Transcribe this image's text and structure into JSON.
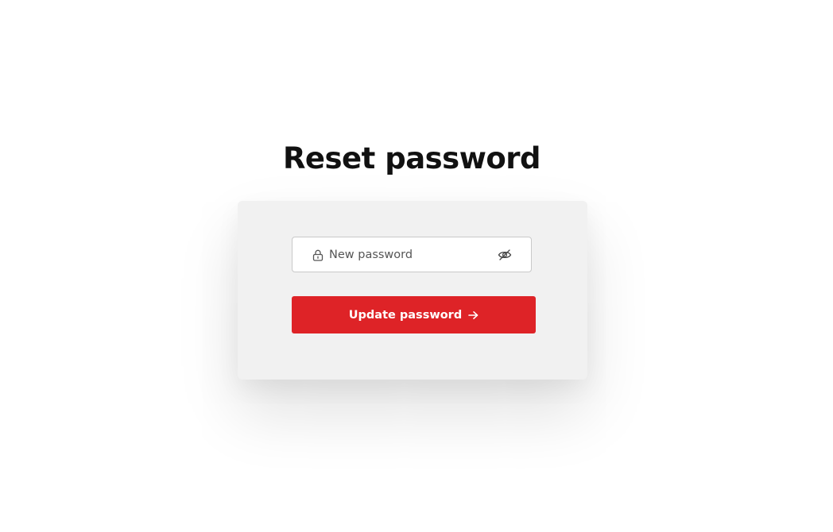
{
  "page": {
    "title": "Reset password"
  },
  "form": {
    "password": {
      "placeholder": "New password",
      "value": "",
      "leading_icon": "lock-icon",
      "toggle_icon": "eye-slash-icon"
    },
    "submit": {
      "label": "Update password",
      "icon": "arrow-right-icon"
    }
  },
  "colors": {
    "accent": "#de2327",
    "card_background": "#f1f1f1",
    "title": "#111111"
  }
}
